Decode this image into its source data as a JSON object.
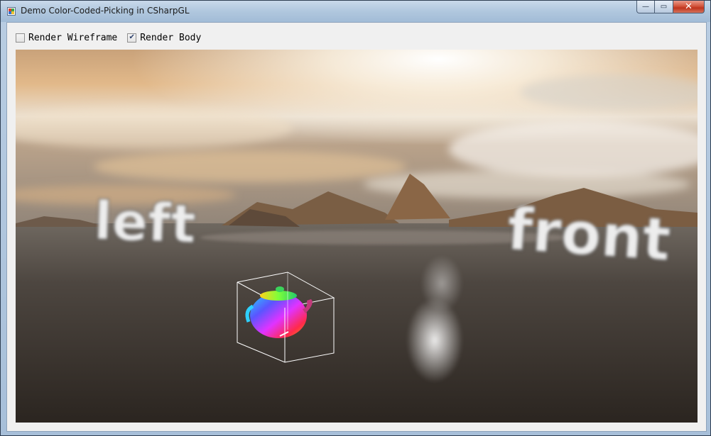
{
  "window": {
    "title": "Demo Color-Coded-Picking in CSharpGL",
    "minimize_glyph": "—",
    "maximize_glyph": "▭",
    "close_glyph": "✕"
  },
  "toolbar": {
    "wireframe": {
      "label": "Render Wireframe",
      "checked": false
    },
    "body": {
      "label": "Render Body",
      "checked": true
    }
  },
  "scene": {
    "text_left": "left",
    "text_front": "front"
  },
  "colors": {
    "title_bar": "#b0c7de",
    "client_bg": "#f0f0f0",
    "close_button": "#c7452b"
  }
}
